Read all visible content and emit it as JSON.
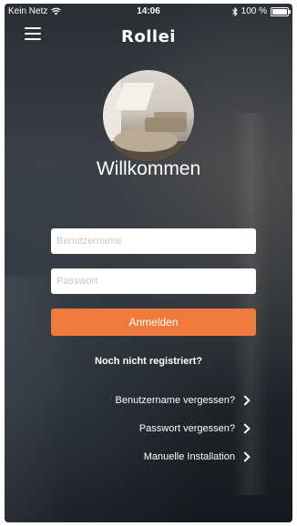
{
  "status_bar": {
    "carrier": "Kein Netz",
    "time": "14:06",
    "battery": "100 %"
  },
  "header": {
    "logo": "Rollei"
  },
  "main": {
    "welcome": "Willkommen",
    "username_placeholder": "Benutzername",
    "password_placeholder": "Passwort",
    "login_label": "Anmelden",
    "register_label": "Noch nicht registriert?",
    "links": [
      "Benutzername vergessen?",
      "Passwort vergessen?",
      "Manuelle Installation"
    ]
  },
  "colors": {
    "accent": "#ee7a3d"
  },
  "icons": [
    "wifi-icon",
    "bluetooth-icon",
    "battery-icon",
    "menu-icon",
    "chevron-right-icon"
  ]
}
